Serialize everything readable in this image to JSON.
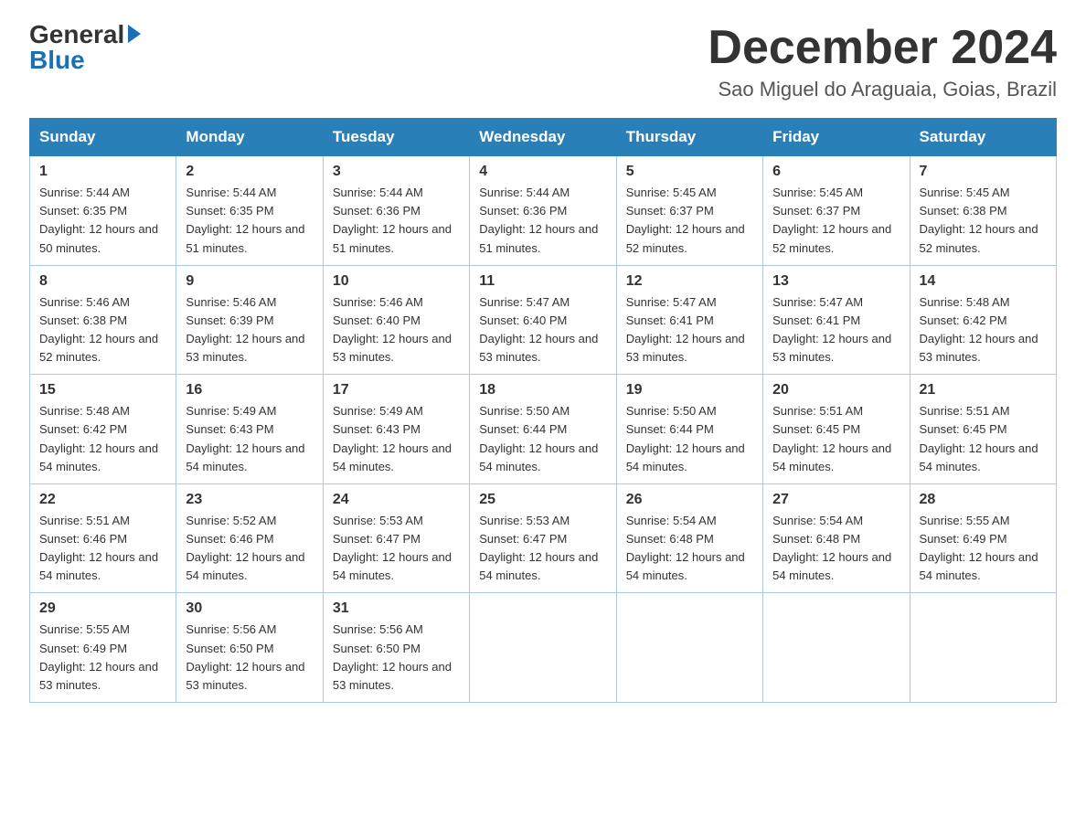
{
  "header": {
    "logo_general": "General",
    "logo_blue": "Blue",
    "month_title": "December 2024",
    "location": "Sao Miguel do Araguaia, Goias, Brazil"
  },
  "weekdays": [
    "Sunday",
    "Monday",
    "Tuesday",
    "Wednesday",
    "Thursday",
    "Friday",
    "Saturday"
  ],
  "weeks": [
    [
      {
        "day": "1",
        "sunrise": "5:44 AM",
        "sunset": "6:35 PM",
        "daylight": "12 hours and 50 minutes."
      },
      {
        "day": "2",
        "sunrise": "5:44 AM",
        "sunset": "6:35 PM",
        "daylight": "12 hours and 51 minutes."
      },
      {
        "day": "3",
        "sunrise": "5:44 AM",
        "sunset": "6:36 PM",
        "daylight": "12 hours and 51 minutes."
      },
      {
        "day": "4",
        "sunrise": "5:44 AM",
        "sunset": "6:36 PM",
        "daylight": "12 hours and 51 minutes."
      },
      {
        "day": "5",
        "sunrise": "5:45 AM",
        "sunset": "6:37 PM",
        "daylight": "12 hours and 52 minutes."
      },
      {
        "day": "6",
        "sunrise": "5:45 AM",
        "sunset": "6:37 PM",
        "daylight": "12 hours and 52 minutes."
      },
      {
        "day": "7",
        "sunrise": "5:45 AM",
        "sunset": "6:38 PM",
        "daylight": "12 hours and 52 minutes."
      }
    ],
    [
      {
        "day": "8",
        "sunrise": "5:46 AM",
        "sunset": "6:38 PM",
        "daylight": "12 hours and 52 minutes."
      },
      {
        "day": "9",
        "sunrise": "5:46 AM",
        "sunset": "6:39 PM",
        "daylight": "12 hours and 53 minutes."
      },
      {
        "day": "10",
        "sunrise": "5:46 AM",
        "sunset": "6:40 PM",
        "daylight": "12 hours and 53 minutes."
      },
      {
        "day": "11",
        "sunrise": "5:47 AM",
        "sunset": "6:40 PM",
        "daylight": "12 hours and 53 minutes."
      },
      {
        "day": "12",
        "sunrise": "5:47 AM",
        "sunset": "6:41 PM",
        "daylight": "12 hours and 53 minutes."
      },
      {
        "day": "13",
        "sunrise": "5:47 AM",
        "sunset": "6:41 PM",
        "daylight": "12 hours and 53 minutes."
      },
      {
        "day": "14",
        "sunrise": "5:48 AM",
        "sunset": "6:42 PM",
        "daylight": "12 hours and 53 minutes."
      }
    ],
    [
      {
        "day": "15",
        "sunrise": "5:48 AM",
        "sunset": "6:42 PM",
        "daylight": "12 hours and 54 minutes."
      },
      {
        "day": "16",
        "sunrise": "5:49 AM",
        "sunset": "6:43 PM",
        "daylight": "12 hours and 54 minutes."
      },
      {
        "day": "17",
        "sunrise": "5:49 AM",
        "sunset": "6:43 PM",
        "daylight": "12 hours and 54 minutes."
      },
      {
        "day": "18",
        "sunrise": "5:50 AM",
        "sunset": "6:44 PM",
        "daylight": "12 hours and 54 minutes."
      },
      {
        "day": "19",
        "sunrise": "5:50 AM",
        "sunset": "6:44 PM",
        "daylight": "12 hours and 54 minutes."
      },
      {
        "day": "20",
        "sunrise": "5:51 AM",
        "sunset": "6:45 PM",
        "daylight": "12 hours and 54 minutes."
      },
      {
        "day": "21",
        "sunrise": "5:51 AM",
        "sunset": "6:45 PM",
        "daylight": "12 hours and 54 minutes."
      }
    ],
    [
      {
        "day": "22",
        "sunrise": "5:51 AM",
        "sunset": "6:46 PM",
        "daylight": "12 hours and 54 minutes."
      },
      {
        "day": "23",
        "sunrise": "5:52 AM",
        "sunset": "6:46 PM",
        "daylight": "12 hours and 54 minutes."
      },
      {
        "day": "24",
        "sunrise": "5:53 AM",
        "sunset": "6:47 PM",
        "daylight": "12 hours and 54 minutes."
      },
      {
        "day": "25",
        "sunrise": "5:53 AM",
        "sunset": "6:47 PM",
        "daylight": "12 hours and 54 minutes."
      },
      {
        "day": "26",
        "sunrise": "5:54 AM",
        "sunset": "6:48 PM",
        "daylight": "12 hours and 54 minutes."
      },
      {
        "day": "27",
        "sunrise": "5:54 AM",
        "sunset": "6:48 PM",
        "daylight": "12 hours and 54 minutes."
      },
      {
        "day": "28",
        "sunrise": "5:55 AM",
        "sunset": "6:49 PM",
        "daylight": "12 hours and 54 minutes."
      }
    ],
    [
      {
        "day": "29",
        "sunrise": "5:55 AM",
        "sunset": "6:49 PM",
        "daylight": "12 hours and 53 minutes."
      },
      {
        "day": "30",
        "sunrise": "5:56 AM",
        "sunset": "6:50 PM",
        "daylight": "12 hours and 53 minutes."
      },
      {
        "day": "31",
        "sunrise": "5:56 AM",
        "sunset": "6:50 PM",
        "daylight": "12 hours and 53 minutes."
      },
      null,
      null,
      null,
      null
    ]
  ]
}
